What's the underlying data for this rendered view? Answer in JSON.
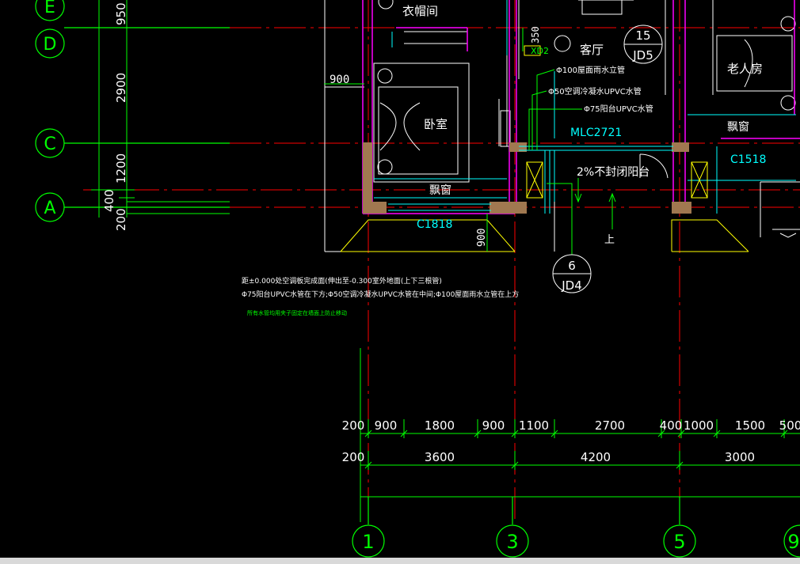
{
  "colors": {
    "background": "#000000",
    "axis_line": "#ff0000",
    "grid_bubble": "#00ff00",
    "wall": "#ff00ff",
    "cyan": "#00ffff",
    "yellow": "#ffff00",
    "white": "#ffffff",
    "dim": "#00ff00"
  },
  "axes_horizontal": {
    "E": {
      "label": "E"
    },
    "D": {
      "label": "D"
    },
    "C": {
      "label": "C"
    },
    "A": {
      "label": "A"
    }
  },
  "axes_vertical": {
    "a1": {
      "label": "1"
    },
    "a3": {
      "label": "3"
    },
    "a5": {
      "label": "5"
    },
    "a9": {
      "label": "9"
    }
  },
  "left_dims": {
    "d1": "950",
    "d2": "2900",
    "d3": "1200",
    "d4": "400",
    "d5": "200"
  },
  "rooms": {
    "closet": "衣帽间",
    "living": "客厅",
    "elder": "老人房",
    "bedroom": "卧室",
    "bay1": "飘窗",
    "bay2": "飘窗",
    "balcony": "2%不封闭阳台"
  },
  "labels": {
    "dim_900_left": "900",
    "dim_350": "350",
    "xd2": "XD2",
    "pipe1": "Φ100屋面雨水立管",
    "pipe2": "Φ50空调冷凝水UPVC水管",
    "pipe3": "Φ75阳台UPVC水管",
    "mlc": "MLC2721",
    "c1518": "C1518",
    "c1818": "C1818",
    "dim_900_mid": "900",
    "up": "上",
    "jd5_num": "15",
    "jd5_ref": "JD5",
    "jd4_num": "6",
    "jd4_ref": "JD4"
  },
  "notes": {
    "line1": "距±0.000处空调板完成面(伸出至-0.300室外地面(上下三根管)",
    "line2": "Φ75阳台UPVC水管在下方;Φ50空调冷凝水UPVC水管在中间;Φ100屋面雨水立管在上方",
    "line3": "所有水管均用夹子固定在墙面上防止移动"
  },
  "dims_row1": [
    "200",
    "900",
    "1800",
    "900",
    "1100",
    "2700",
    "400",
    "1000",
    "1500",
    "500"
  ],
  "dims_row2": [
    "200",
    "3600",
    "4200",
    "3000"
  ]
}
